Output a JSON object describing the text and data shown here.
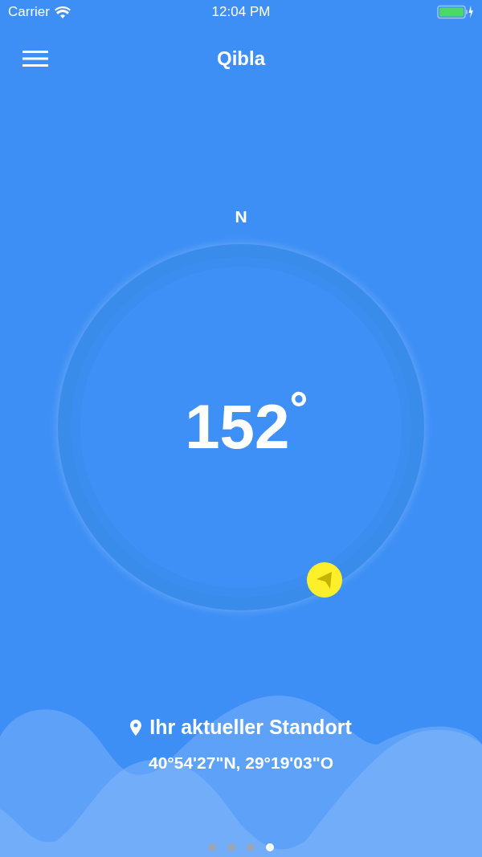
{
  "status_bar": {
    "carrier": "Carrier",
    "time": "12:04 PM"
  },
  "nav": {
    "title": "Qibla"
  },
  "compass": {
    "north_label": "N",
    "heading": "152$^{°}$"
  },
  "location": {
    "label": "Ihr aktueller Standort",
    "coordinates": "40°54'27\"N, 29°19'03\"O"
  },
  "pages": [
    {
      "selected": false
    },
    {
      "selected": false
    },
    {
      "selected": false
    },
    {
      "selected": true
    }
  ]
}
